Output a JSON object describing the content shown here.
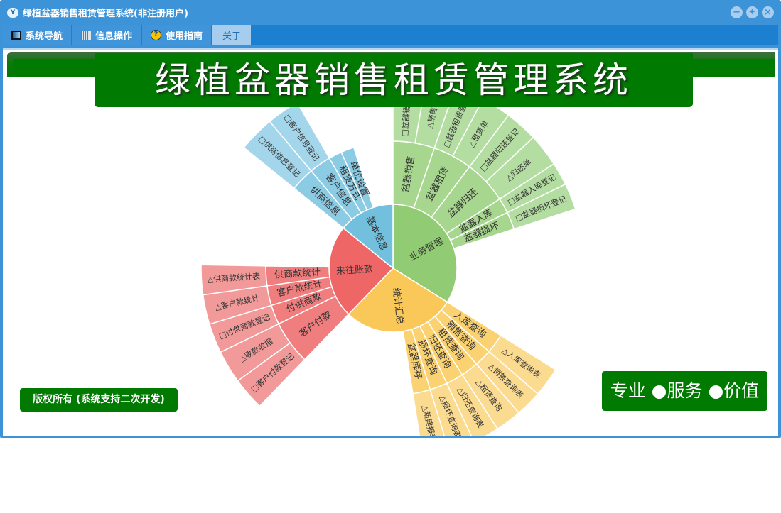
{
  "window": {
    "title": "绿植盆器销售租赁管理系统(非注册用户)",
    "controls": [
      "minimize",
      "restore",
      "close"
    ]
  },
  "tabs": [
    {
      "label": "系统导航",
      "icon": "monitor-icon"
    },
    {
      "label": "信息操作",
      "icon": "grid-icon"
    },
    {
      "label": "使用指南",
      "icon": "help-icon"
    },
    {
      "label": "关于",
      "active": true
    }
  ],
  "banner": {
    "title": "绿植盆器销售租赁管理系统"
  },
  "footer": {
    "copyright": "版权所有 (系统支持二次开发)",
    "slogan": "专业 ●服务 ●价值"
  },
  "colors": {
    "green": [
      "#91cb74",
      "#a7d68f",
      "#b4dda2"
    ],
    "yellow": [
      "#fac858",
      "#fbd271",
      "#fbdb90"
    ],
    "red": [
      "#ee6666",
      "#f07e7e",
      "#f29a9a"
    ],
    "blue": [
      "#73c0de",
      "#8bcbe4",
      "#a3d6ea"
    ]
  },
  "chart_data": {
    "type": "sunburst",
    "start_angle": 0,
    "nodes": [
      {
        "name": "业务管理",
        "color": "green",
        "value": 122,
        "children": [
          {
            "name": "盆器销售",
            "value": 19,
            "children": [
              {
                "name": "□盆器销售登记",
                "value": 10
              },
              {
                "name": "△销售单",
                "value": 9
              }
            ]
          },
          {
            "name": "盆器租赁",
            "value": 18,
            "children": [
              {
                "name": "□盆器租赁登记",
                "value": 9
              },
              {
                "name": "△租赁单",
                "value": 9
              }
            ]
          },
          {
            "name": "盆器归还",
            "value": 20,
            "children": [
              {
                "name": "□盆器归还登记",
                "value": 10
              },
              {
                "name": "△归还单",
                "value": 10
              }
            ]
          },
          {
            "name": "盆器入库",
            "value": 7,
            "children": [
              {
                "name": "□盆器入库登记",
                "value": 7
              }
            ]
          },
          {
            "name": "盆器损坏",
            "value": 8,
            "children": [
              {
                "name": "□盆器损坏登记",
                "value": 8
              }
            ]
          }
        ]
      },
      {
        "name": "统计汇总",
        "color": "yellow",
        "value": 102,
        "children": [
          {
            "name": "入库查询",
            "value": 9,
            "children": [
              {
                "name": "△入库查询表",
                "value": 9
              }
            ]
          },
          {
            "name": "销售查询",
            "value": 8,
            "children": [
              {
                "name": "△销售查询表",
                "value": 8
              }
            ]
          },
          {
            "name": "租赁查询",
            "value": 8,
            "children": [
              {
                "name": "△租赁查询",
                "value": 8
              }
            ]
          },
          {
            "name": "归还查询",
            "value": 8,
            "children": [
              {
                "name": "△归还查询表",
                "value": 8
              }
            ]
          },
          {
            "name": "损坏查询",
            "value": 8,
            "children": [
              {
                "name": "△损坏查询表",
                "value": 8
              }
            ]
          },
          {
            "name": "盆器库存",
            "value": 8,
            "children": [
              {
                "name": "△新建报表",
                "value": 8
              }
            ]
          }
        ]
      },
      {
        "name": "来往账款",
        "color": "red",
        "value": 85,
        "children": [
          {
            "name": "客户付款",
            "value": 20,
            "children": [
              {
                "name": "□客户付款登记",
                "value": 10
              },
              {
                "name": "△收款收据",
                "value": 10
              }
            ]
          },
          {
            "name": "付供商款",
            "value": 9,
            "children": [
              {
                "name": "□付供商款登记",
                "value": 9
              }
            ]
          },
          {
            "name": "客户款统计",
            "value": 9,
            "children": [
              {
                "name": "△客户款统计",
                "value": 9
              }
            ]
          },
          {
            "name": "供商款统计",
            "value": 9,
            "children": [
              {
                "name": "△供商款统计表",
                "value": 9
              }
            ]
          }
        ]
      },
      {
        "name": "基本信息",
        "color": "blue",
        "value": 51,
        "children": [
          {
            "name": "供商信息",
            "value": 11,
            "children": [
              {
                "name": "□供商信息登记",
                "value": 11
              }
            ]
          },
          {
            "name": "客户信息",
            "value": 10,
            "children": [
              {
                "name": "□客户信息登记",
                "value": 10
              }
            ]
          },
          {
            "name": "租赁方式",
            "value": 6,
            "children": []
          },
          {
            "name": "单位设置",
            "value": 6,
            "children": []
          }
        ]
      }
    ]
  }
}
